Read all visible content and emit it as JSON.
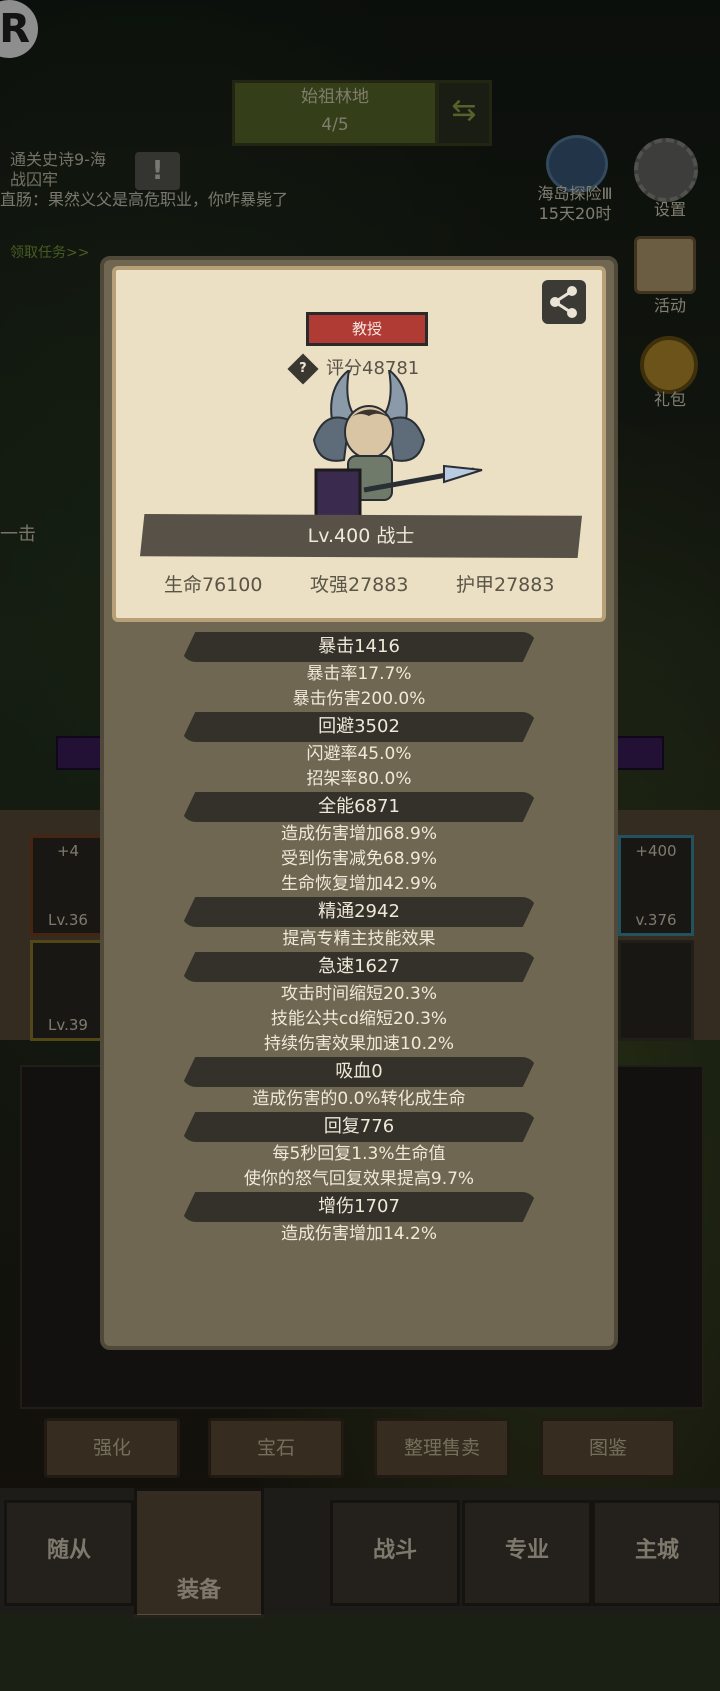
{
  "background": {
    "logo_letter": "R",
    "stage": {
      "name": "始祖林地",
      "progress": "4/5"
    },
    "quest_lines": [
      "通关史诗9-海",
      "战囚牢",
      "直肠：果然义父是高危职业，你咋暴毙了"
    ],
    "quest_link": "领取任务>>",
    "side_menu": [
      {
        "label": "海岛探险Ⅲ",
        "sub": "15天20时",
        "icon": "island-icon"
      },
      {
        "label": "设置",
        "icon": "gear-icon"
      },
      {
        "label": "活动",
        "icon": "scroll-icon"
      },
      {
        "label": "礼包",
        "icon": "gift-icon"
      }
    ],
    "left_partial_text": "一击",
    "equip_slots": [
      {
        "plus": "+4",
        "level": "Lv.36"
      },
      {
        "plus": "",
        "level": "Lv.39"
      },
      {
        "plus": "+400",
        "level": "v.376"
      }
    ],
    "action_buttons": [
      "强化",
      "宝石",
      "整理售卖",
      "图鉴"
    ],
    "nav": [
      "随从",
      "装备",
      "战斗",
      "专业",
      "主城"
    ]
  },
  "character": {
    "title": "教授",
    "score": "评分48781",
    "level_class": "Lv.400 战士",
    "base_stats": [
      "生命76100",
      "攻强27883",
      "护甲27883"
    ]
  },
  "stats": [
    {
      "head": "暴击1416",
      "lines": [
        "暴击率17.7%",
        "暴击伤害200.0%"
      ]
    },
    {
      "head": "回避3502",
      "lines": [
        "闪避率45.0%",
        "招架率80.0%"
      ]
    },
    {
      "head": "全能6871",
      "lines": [
        "造成伤害增加68.9%",
        "受到伤害减免68.9%",
        "生命恢复增加42.9%"
      ]
    },
    {
      "head": "精通2942",
      "lines": [
        "提高专精主技能效果"
      ]
    },
    {
      "head": "急速1627",
      "lines": [
        "攻击时间缩短20.3%",
        "技能公共cd缩短20.3%",
        "持续伤害效果加速10.2%"
      ]
    },
    {
      "head": "吸血0",
      "lines": [
        "造成伤害的0.0%转化成生命"
      ]
    },
    {
      "head": "回复776",
      "lines": [
        "每5秒回复1.3%生命值",
        "使你的怒气回复效果提高9.7%"
      ]
    },
    {
      "head": "增伤1707",
      "lines": [
        "造成伤害增加14.2%"
      ]
    }
  ]
}
